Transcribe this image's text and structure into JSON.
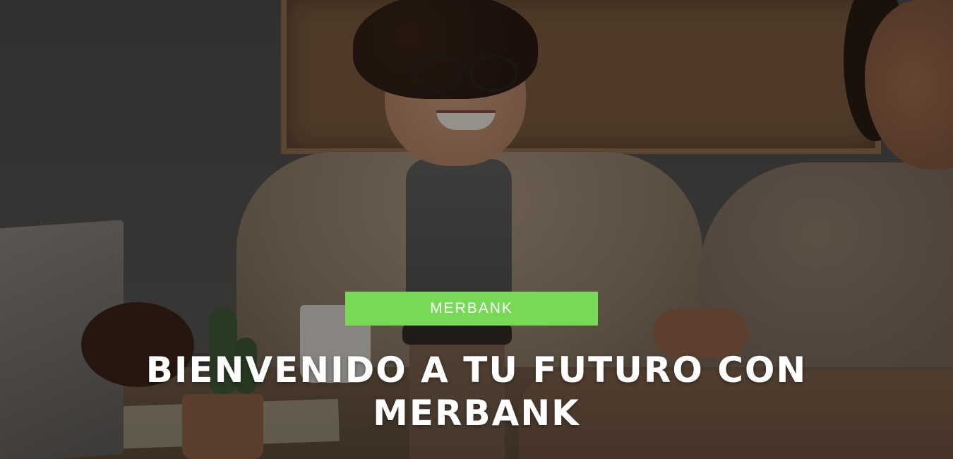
{
  "hero": {
    "badge_label": "MERBANK",
    "headline_line1": "BIENVENIDO A TU FUTURO CON",
    "headline_line2": "MERBANK"
  },
  "colors": {
    "badge_background": "#78d957",
    "headline_text": "#ffffff",
    "overlay_dim": "rgba(0,0,0,0.35)"
  }
}
